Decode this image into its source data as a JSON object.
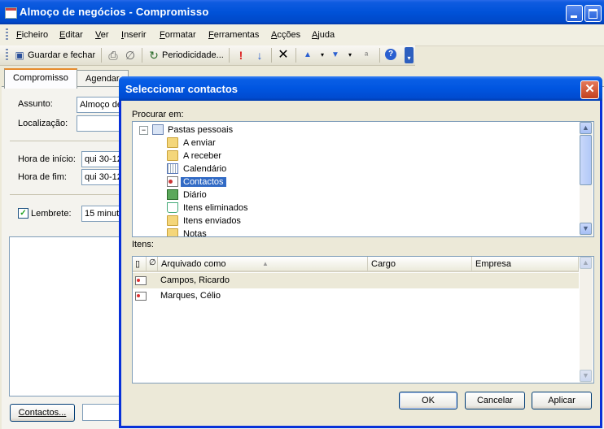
{
  "window": {
    "title": "Almoço de negócios - Compromisso"
  },
  "menu": [
    "Ficheiro",
    "Editar",
    "Ver",
    "Inserir",
    "Formatar",
    "Ferramentas",
    "Acções",
    "Ajuda"
  ],
  "toolbar": {
    "save_close": "Guardar e fechar",
    "recurrence": "Periodicidade..."
  },
  "tabs": [
    "Compromisso",
    "Agendar"
  ],
  "form": {
    "subject_label": "Assunto:",
    "subject_value": "Almoço de",
    "location_label": "Localização:",
    "location_value": "",
    "start_label": "Hora de início:",
    "start_value": "qui 30-12",
    "end_label": "Hora de fim:",
    "end_value": "qui 30-12",
    "reminder_label": "Lembrete:",
    "reminder_value": "15 minuto",
    "contacts_button": "Contactos..."
  },
  "dialog": {
    "title": "Seleccionar contactos",
    "look_in_label": "Procurar em:",
    "tree": {
      "root": "Pastas pessoais",
      "items": [
        {
          "label": "A enviar",
          "icon": "outbox-folder-icon"
        },
        {
          "label": "A receber",
          "icon": "inbox-folder-icon"
        },
        {
          "label": "Calendário",
          "icon": "calendar-icon"
        },
        {
          "label": "Contactos",
          "icon": "contacts-icon"
        },
        {
          "label": "Diário",
          "icon": "journal-icon"
        },
        {
          "label": "Itens eliminados",
          "icon": "deleted-items-icon"
        },
        {
          "label": "Itens enviados",
          "icon": "sent-items-icon"
        },
        {
          "label": "Notas",
          "icon": "notes-folder-icon"
        }
      ],
      "selected": "Contactos"
    },
    "items_label": "Itens:",
    "columns": [
      "Arquivado como",
      "Cargo",
      "Empresa"
    ],
    "rows": [
      {
        "filed_as": "Campos, Ricardo",
        "job": "",
        "company": ""
      },
      {
        "filed_as": "Marques, Célio",
        "job": "",
        "company": ""
      }
    ],
    "buttons": {
      "ok": "OK",
      "cancel": "Cancelar",
      "apply": "Aplicar"
    }
  },
  "colors": {
    "titlebar": "#0052D8",
    "selection": "#316AC5",
    "tab_accent": "#E68B2C",
    "face": "#ECE9D8"
  }
}
